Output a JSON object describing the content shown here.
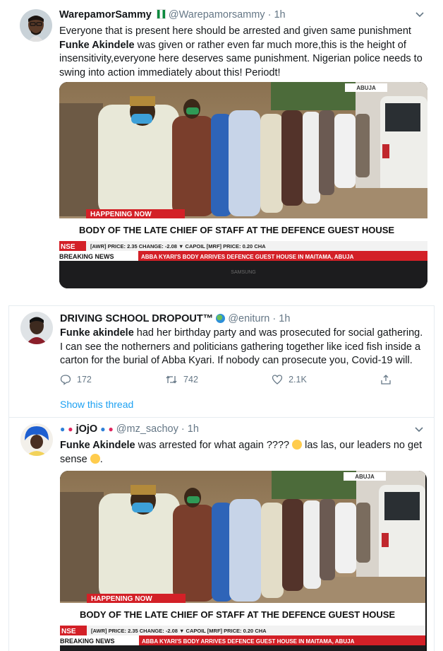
{
  "tweets": [
    {
      "name": "WarepamorSammy",
      "handle": "@Warepamorsammy",
      "time": "1h",
      "text_parts": [
        "Everyone that is present here should be arrested and given same punishment",
        "Funke Akindele",
        " was given or rather even far much more,this is the height of insensitivity,everyone here deserves same punishment. Nigerian police needs to swing into action immediately about this! Periodt!"
      ],
      "media": {
        "badge": "ABUJA",
        "happening": "HAPPENING NOW",
        "headline": "BODY OF THE LATE CHIEF OF STAFF AT THE DEFENCE GUEST HOUSE",
        "ticker_left": "NSE",
        "ticker": "[AWR]   PRICE: 2.35   CHANGE: -2.08 ▼   CAPOIL [MRF]   PRICE: 0.20   CHA",
        "breaking": "BREAKING NEWS",
        "crawl": "ABBA KYARI'S BODY ARRIVES DEFENCE GUEST HOUSE IN MAITAMA, ABUJA",
        "brand": "SAMSUNG"
      }
    },
    {
      "name": "DRIVING SCHOOL DROPOUT™",
      "handle": "@eniturn",
      "time": "1h",
      "text_parts": [
        "Funke akindele",
        " had her birthday party and was prosecuted for social gathering. I can see the notherners and politicians gathering together like  iced fish inside a carton for the burial of Abba Kyari. If nobody can prosecute you, Covid-19 will."
      ],
      "actions": {
        "replies": "172",
        "retweets": "742",
        "likes": "2.1K"
      },
      "show_thread": "Show this thread"
    },
    {
      "name": "jOjO",
      "handle": "@mz_sachoy",
      "time": "1h",
      "text_parts": [
        "Funke Akindele",
        " was arrested for what again ????",
        " las las, our leaders no get sense",
        "."
      ],
      "media": {
        "badge": "ABUJA",
        "happening": "HAPPENING NOW",
        "headline": "BODY OF THE LATE CHIEF OF STAFF AT THE DEFENCE GUEST HOUSE",
        "ticker_left": "NSE",
        "ticker": "[AWR]   PRICE: 2.35   CHANGE: -2.08 ▼   CAPOIL [MRF]   PRICE: 0.20   CHA",
        "breaking": "BREAKING NEWS",
        "crawl": "ABBA KYARI'S BODY ARRIVES DEFENCE GUEST HOUSE IN MAITAMA, ABUJA"
      }
    }
  ],
  "colors": {
    "link": "#1da1f2",
    "secondary": "#657786",
    "border": "#e6ecf0",
    "tv_red": "#d32027"
  }
}
